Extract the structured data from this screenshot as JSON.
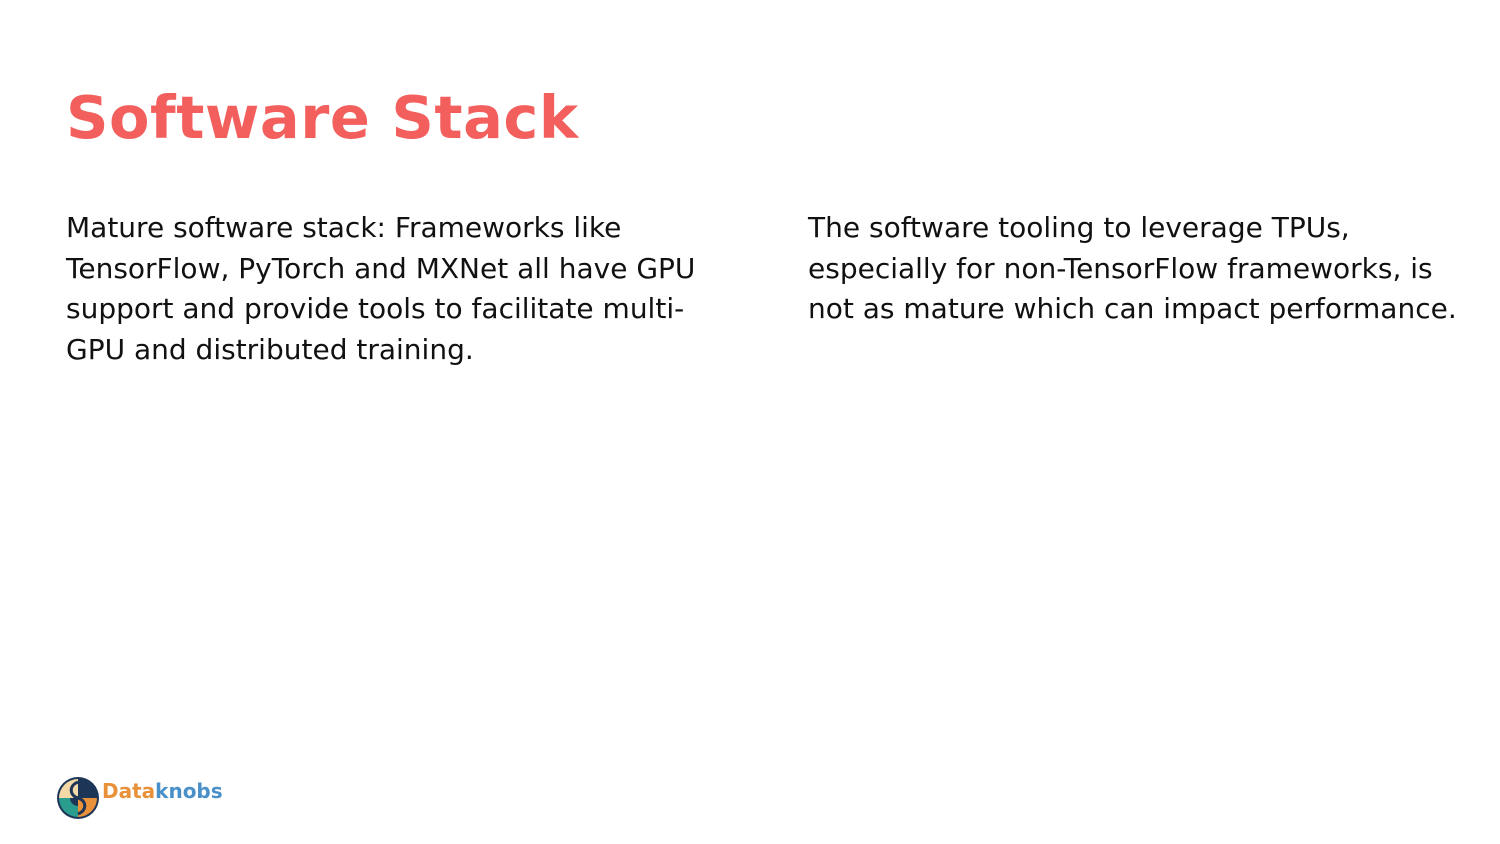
{
  "slide": {
    "title": "Software Stack",
    "columns": [
      {
        "text": "Mature software stack: Frameworks like TensorFlow, PyTorch and MXNet all have GPU support and provide tools to facilitate multi-GPU and distributed training."
      },
      {
        "text": "The software tooling to leverage TPUs, especially for non-TensorFlow frameworks, is not as mature which can impact performance."
      }
    ]
  },
  "brand": {
    "name_part_1": "Data",
    "name_part_2": "knobs",
    "icon": "dataknobs-logo-icon"
  },
  "colors": {
    "title": "#f25f5c",
    "body_text": "#111111",
    "brand_orange": "#e8913a",
    "brand_blue": "#4a90c8",
    "logo_teal": "#2a9d8f",
    "logo_navy": "#1d3557"
  }
}
